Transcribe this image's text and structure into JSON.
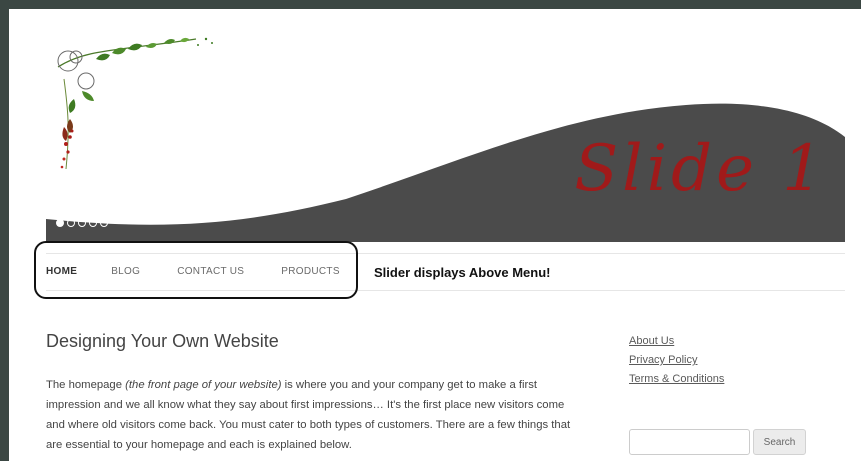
{
  "slider": {
    "slide_text": "Slide 1",
    "dots": 5,
    "active_dot": 0,
    "colors": {
      "wave": "#4a4a4a",
      "text_red": "#a01a1a",
      "text_green": "#2e6e1e"
    }
  },
  "nav": {
    "items": [
      {
        "label": "HOME",
        "active": true
      },
      {
        "label": "BLOG",
        "active": false
      },
      {
        "label": "CONTACT US",
        "active": false
      },
      {
        "label": "PRODUCTS",
        "active": false
      }
    ],
    "callout": "Slider displays Above Menu!"
  },
  "main": {
    "title": "Designing Your Own Website",
    "paragraph": {
      "pre": "The homepage ",
      "em": "(the front page of your website)",
      "post": " is where you and your company get to make a first impression and we all know what they say about first impressions… It's the first place new visitors come and where old visitors come back. You must cater to both types of customers. There are a few things that are essential to your homepage and each is explained below."
    }
  },
  "sidebar": {
    "links": [
      "About Us",
      "Privacy Policy",
      "Terms & Conditions"
    ],
    "search": {
      "placeholder": "",
      "button_label": "Search"
    }
  }
}
